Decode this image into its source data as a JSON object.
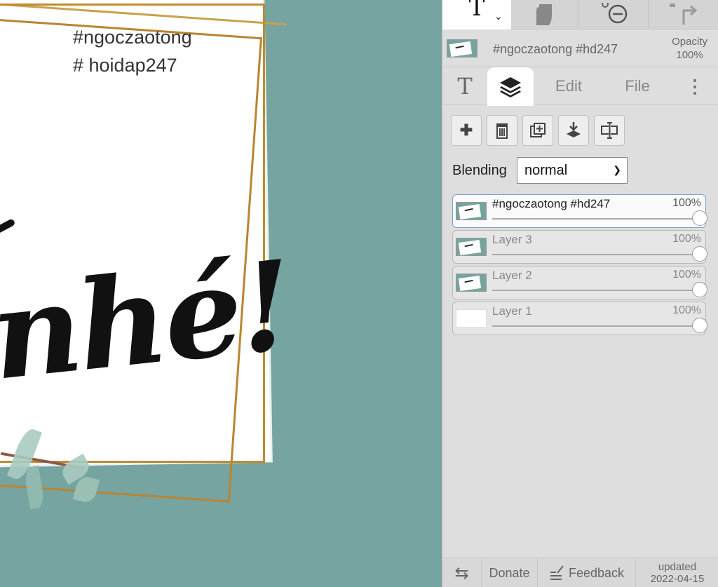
{
  "canvas": {
    "text_line1": "#ngoczaotong",
    "text_line2": "# hoidap247",
    "big_text": "nhé!",
    "background_color": "#76a4a0",
    "frame_color": "#c08b2f"
  },
  "toolbar": {
    "text_tool_glyph": "T",
    "text_tool_dropdown": "⌄",
    "hand_tool_icon": "hand-icon",
    "zoom_out_icon": "zoom-out-icon",
    "redo_icon": "redo-icon"
  },
  "document": {
    "name": "#ngoczaotong #hd247",
    "opacity_label": "Opacity",
    "opacity_value": "100%"
  },
  "tabs": {
    "text_glyph": "T",
    "layers_icon": "layers-icon",
    "edit": "Edit",
    "file": "File",
    "more": "⋮"
  },
  "layer_tools": {
    "add": "✚",
    "delete_icon": "trash-icon",
    "duplicate_icon": "duplicate-icon",
    "merge_icon": "merge-down-icon",
    "properties_icon": "text-cursor-icon"
  },
  "blending": {
    "label": "Blending",
    "value": "normal"
  },
  "layers": [
    {
      "name": "#ngoczaotong #hd247",
      "opacity": "100%",
      "opacity_fraction": 1.0,
      "selected": true
    },
    {
      "name": "Layer 3",
      "opacity": "100%",
      "opacity_fraction": 1.0,
      "selected": false
    },
    {
      "name": "Layer 2",
      "opacity": "100%",
      "opacity_fraction": 1.0,
      "selected": false
    },
    {
      "name": "Layer 1",
      "opacity": "100%",
      "opacity_fraction": 1.0,
      "selected": false
    }
  ],
  "footer": {
    "swap": "⇆",
    "donate": "Donate",
    "feedback": "Feedback",
    "updated_label": "updated",
    "updated_date": "2022-04-15"
  }
}
